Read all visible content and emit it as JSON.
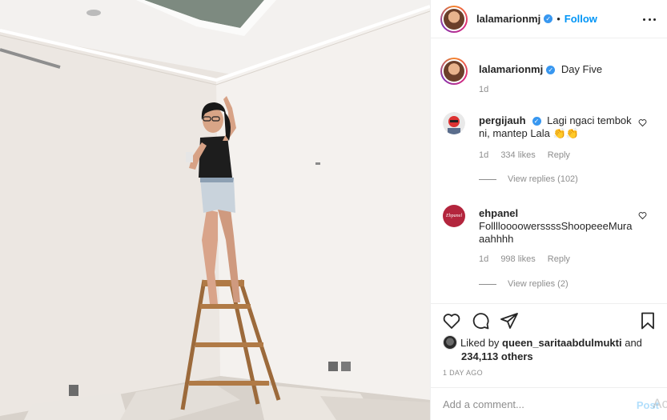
{
  "post": {
    "username": "lalamarionmj",
    "follow_label": "Follow",
    "separator": "•",
    "caption": "Day Five",
    "caption_time": "1d"
  },
  "comments": [
    {
      "username": "pergijauh",
      "text": "Lagi ngaci tembok ni, mantep Lala 👏👏",
      "time": "1d",
      "likes": "334 likes",
      "reply_label": "Reply",
      "view_replies": "View replies (102)"
    },
    {
      "username": "ehpanel",
      "avatar_text": "Ehpanel",
      "text": "FolllloooowerssssShoopeeeMuraaahhhh",
      "time": "1d",
      "likes": "998 likes",
      "reply_label": "Reply",
      "view_replies": "View replies (2)"
    }
  ],
  "likes": {
    "prefix": "Liked by",
    "user": "queen_saritaabdulmukti",
    "and": "and",
    "count_line": "234,113 others"
  },
  "date": "1 DAY AGO",
  "add_comment": {
    "placeholder": "Add a comment...",
    "post_label": "Post"
  },
  "watermark": "Ac",
  "colors": {
    "link_blue": "#0095f6",
    "verified_blue": "#3897f0",
    "post_disabled": "#b2dffc",
    "secondary_text": "#8e8e8e",
    "ehpanel_brand": "#b3253d"
  },
  "icons": [
    "more-icon",
    "verified-icon",
    "heart-icon",
    "comment-icon",
    "share-icon",
    "bookmark-icon"
  ]
}
